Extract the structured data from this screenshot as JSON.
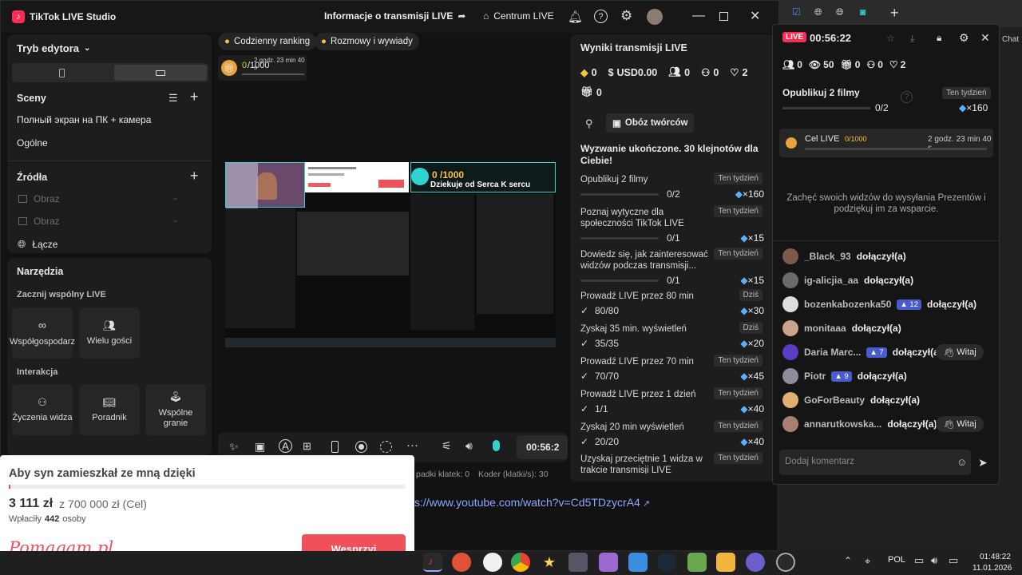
{
  "app": {
    "title": "TikTok LIVE Studio",
    "stream_info": "Informacje o transmisji LIVE",
    "center": "Centrum LIVE"
  },
  "left": {
    "mode": "Tryb edytora",
    "scenes_title": "Sceny",
    "scenes": [
      "Полный экран на ПК + камера",
      "Ogólne"
    ],
    "sources_title": "Źródła",
    "sources": [
      "Obraz",
      "Obraz",
      "Łącze"
    ],
    "tools_title": "Narzędzia",
    "collab_title": "Zacznij wspólny LIVE",
    "collab": [
      "Współgospodarz",
      "Wielu gości"
    ],
    "interaction_title": "Interakcja",
    "interaction": [
      "Życzenia widza",
      "Poradnik",
      "Wspólne granie"
    ]
  },
  "preview": {
    "chip1": "Codzienny ranking",
    "chip2": "Rozmowy i wywiady",
    "goal_current": "0",
    "goal_total": "/1000",
    "goal_time": "2 godz. 23 min 40 s",
    "overlay_goal": "0 /1000",
    "overlay_thanks": "Dziekuje od Serca K sercu"
  },
  "controls": {
    "timer": "00:56:2",
    "dropped": "padki klatek: 0",
    "encoder": "Koder (klatki/s): 30"
  },
  "url_text": "s://www.youtube.com/watch?v=Cd5TDzycrA4",
  "results": {
    "title": "Wyniki transmisji LIVE",
    "stats": {
      "diamonds": "0",
      "usd": "USD0.00",
      "viewers": "0",
      "followers": "0",
      "likes": "2",
      "gifts": "0"
    },
    "camp": "Obóz twórców",
    "challenge": "Wyzwanie ukończone. 30 klejnotów dla Ciebie!",
    "tasks": [
      {
        "name": "Opublikuj 2 filmy",
        "badge": "Ten tydzień",
        "progress": "0/2",
        "reward": "×160",
        "done": false
      },
      {
        "name": "Poznaj wytyczne dla społeczności TikTok LIVE",
        "badge": "Ten tydzień",
        "progress": "0/1",
        "reward": "×15",
        "done": false
      },
      {
        "name": "Dowiedz się, jak zainteresować widzów podczas transmisji...",
        "badge": "Ten tydzień",
        "progress": "0/1",
        "reward": "×15",
        "done": false
      },
      {
        "name": "Prowadź LIVE przez 80 min",
        "badge": "Dziś",
        "progress": "80/80",
        "reward": "×30",
        "done": true
      },
      {
        "name": "Zyskaj 35 min. wyświetleń",
        "badge": "Dziś",
        "progress": "35/35",
        "reward": "×20",
        "done": true
      },
      {
        "name": "Prowadź LIVE przez 70 min",
        "badge": "Ten tydzień",
        "progress": "70/70",
        "reward": "×45",
        "done": true
      },
      {
        "name": "Prowadź LIVE przez 1 dzień",
        "badge": "Ten tydzień",
        "progress": "1/1",
        "reward": "×40",
        "done": true
      },
      {
        "name": "Zyskaj 20 min wyświetleń",
        "badge": "Ten tydzień",
        "progress": "20/20",
        "reward": "×40",
        "done": true
      },
      {
        "name": "Uzyskaj przeciętnie 1 widza w trakcie transmisji LIVE",
        "badge": "Ten tydzień",
        "progress": "",
        "reward": "",
        "done": false
      }
    ]
  },
  "chat": {
    "live": "LIVE",
    "time": "00:56:22",
    "viewers": "0",
    "views": "50",
    "gifts": "0",
    "likes_g": "0",
    "likes": "2",
    "suffix": "Chat",
    "publish_title": "Opublikuj 2 filmy",
    "publish_progress": "0/2",
    "publish_badge": "Ten tydzień",
    "publish_reward": "×160",
    "goal_label": "Cel LIVE",
    "goal_value": "0/1000",
    "goal_time": "2 godz. 23 min 40 s",
    "encourage": "Zachęć swoich widzów do wysyłania Prezentów i podziękuj im za wsparcie.",
    "joined": "dołączył(a)",
    "witaj": "Witaj",
    "comment_placeholder": "Dodaj komentarz",
    "users": [
      {
        "name": "_Black_93",
        "level": "",
        "color": "#7b5a48"
      },
      {
        "name": "ig-alicjia_aa",
        "level": "",
        "color": "#6a6a6a"
      },
      {
        "name": "bozenkabozenka50",
        "level": "12",
        "color": "#dddddd"
      },
      {
        "name": "monitaaa",
        "level": "",
        "color": "#c9a48a"
      },
      {
        "name": "Daria Marc...",
        "level": "7",
        "color": "#5b3cc4"
      },
      {
        "name": "Piotr",
        "level": "9",
        "color": "#8c8c9c"
      },
      {
        "name": "GoForBeauty",
        "level": "",
        "color": "#e0b070"
      },
      {
        "name": "annarutkowska...",
        "level": "",
        "color": "#a88070"
      }
    ]
  },
  "donation": {
    "title": "Aby syn zamieszkał ze mną dzięki",
    "amount": "3 111 zł",
    "target": "z 700 000 zł (Cel)",
    "paid_label": "Wpłaciły",
    "paid_count": "442",
    "paid_suffix": "osoby",
    "brand": "Pomagam.pl",
    "support": "Wesprzyj"
  },
  "tray": {
    "lang": "POL",
    "time": "01:48:22",
    "date": "11.01.2026"
  },
  "colors": {
    "accent": "#fe2c55",
    "teal": "#2fd3d0",
    "donate": "#f0505a"
  }
}
